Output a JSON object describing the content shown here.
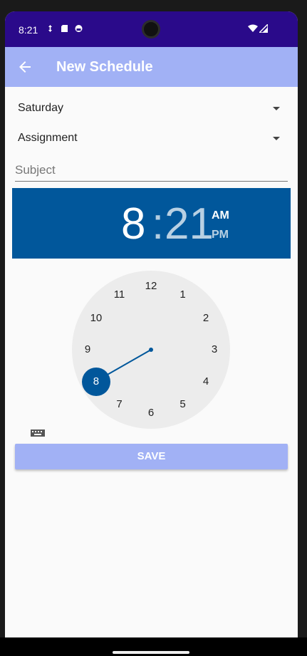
{
  "status_bar": {
    "time": "8:21",
    "icons": [
      "sync-icon",
      "sd-card-icon",
      "android-icon"
    ],
    "right_icons": [
      "wifi-icon",
      "signal-icon"
    ]
  },
  "app_bar": {
    "title": "New Schedule",
    "back_icon": "arrow-back-icon",
    "color": "#a1b1f5"
  },
  "form": {
    "day_selected": "Saturday",
    "type_selected": "Assignment",
    "subject_placeholder": "Subject",
    "subject_value": ""
  },
  "time_picker": {
    "hour": "8",
    "separator": ":",
    "minute": "21",
    "am_label": "AM",
    "pm_label": "PM",
    "period_selected": "AM",
    "header_color": "#01579b",
    "clock_numbers": [
      "12",
      "1",
      "2",
      "3",
      "4",
      "5",
      "6",
      "7",
      "8",
      "9",
      "10",
      "11"
    ],
    "selected_number": "8",
    "keyboard_icon": "keyboard-icon"
  },
  "actions": {
    "save_label": "SAVE"
  }
}
